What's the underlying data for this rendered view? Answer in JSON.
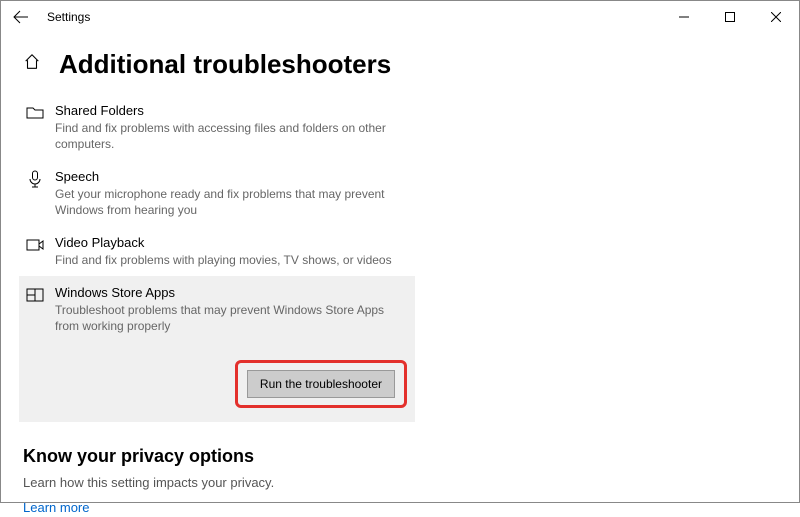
{
  "window": {
    "app_title": "Settings"
  },
  "page": {
    "title": "Additional troubleshooters"
  },
  "troubleshooters": [
    {
      "title": "Shared Folders",
      "desc": "Find and fix problems with accessing files and folders on other computers."
    },
    {
      "title": "Speech",
      "desc": "Get your microphone ready and fix problems that may prevent Windows from hearing you"
    },
    {
      "title": "Video Playback",
      "desc": "Find and fix problems with playing movies, TV shows, or videos"
    },
    {
      "title": "Windows Store Apps",
      "desc": "Troubleshoot problems that may prevent Windows Store Apps from working properly"
    }
  ],
  "actions": {
    "run_label": "Run the troubleshooter"
  },
  "privacy": {
    "heading": "Know your privacy options",
    "desc": "Learn how this setting impacts your privacy.",
    "link": "Learn more"
  }
}
